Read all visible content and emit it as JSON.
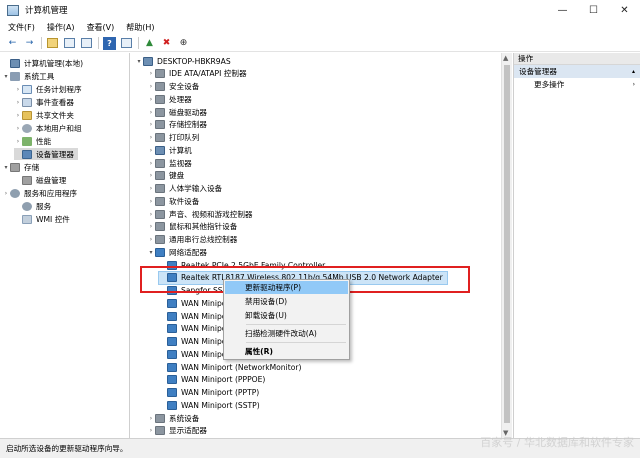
{
  "window": {
    "title": "计算机管理"
  },
  "window_controls": {
    "minimize": "—",
    "maximize": "☐",
    "close": "✕"
  },
  "menu": [
    "文件(F)",
    "操作(A)",
    "查看(V)",
    "帮助(H)"
  ],
  "toolbar_glyphs": {
    "back": "←",
    "forward": "→",
    "help": "?",
    "update": "▲",
    "delete": "✖",
    "scan": "⊕"
  },
  "left_tree": [
    {
      "label": "计算机管理(本地)",
      "icon": "computer-icon",
      "exp": ""
    },
    {
      "label": "系统工具",
      "icon": "tools-icon",
      "exp": "▾"
    },
    {
      "label": "任务计划程序",
      "icon": "task-scheduler-icon",
      "exp": "›"
    },
    {
      "label": "事件查看器",
      "icon": "event-viewer-icon",
      "exp": "›"
    },
    {
      "label": "共享文件夹",
      "icon": "shared-folder-icon",
      "exp": "›"
    },
    {
      "label": "本地用户和组",
      "icon": "users-icon",
      "exp": "›"
    },
    {
      "label": "性能",
      "icon": "performance-icon",
      "exp": "›"
    },
    {
      "label": "设备管理器",
      "icon": "device-manager-icon",
      "exp": ""
    },
    {
      "label": "存储",
      "icon": "storage-icon",
      "exp": "▾"
    },
    {
      "label": "磁盘管理",
      "icon": "disk-icon",
      "exp": ""
    },
    {
      "label": "服务和应用程序",
      "icon": "services-apps-icon",
      "exp": "›"
    },
    {
      "label": "服务",
      "icon": "services-icon",
      "exp": ""
    },
    {
      "label": "WMI 控件",
      "icon": "wmi-icon",
      "exp": ""
    }
  ],
  "device_tree": [
    {
      "label": "DESKTOP-HBKR9AS",
      "icon": "computer-icon",
      "exp": "▾"
    },
    {
      "label": "IDE ATA/ATAPI 控制器",
      "icon": "ide-controller-icon",
      "exp": "›"
    },
    {
      "label": "安全设备",
      "icon": "security-device-icon",
      "exp": "›"
    },
    {
      "label": "处理器",
      "icon": "processor-icon",
      "exp": "›"
    },
    {
      "label": "磁盘驱动器",
      "icon": "disk-drive-icon",
      "exp": "›"
    },
    {
      "label": "存储控制器",
      "icon": "storage-controller-icon",
      "exp": "›"
    },
    {
      "label": "打印队列",
      "icon": "printer-icon",
      "exp": "›"
    },
    {
      "label": "计算机",
      "icon": "computer-icon",
      "exp": "›"
    },
    {
      "label": "监视器",
      "icon": "monitor-icon",
      "exp": "›"
    },
    {
      "label": "键盘",
      "icon": "keyboard-icon",
      "exp": "›"
    },
    {
      "label": "人体学输入设备",
      "icon": "hid-icon",
      "exp": "›"
    },
    {
      "label": "软件设备",
      "icon": "software-device-icon",
      "exp": "›"
    },
    {
      "label": "声音、视频和游戏控制器",
      "icon": "sound-icon",
      "exp": "›"
    },
    {
      "label": "鼠标和其他指针设备",
      "icon": "mouse-icon",
      "exp": "›"
    },
    {
      "label": "通用串行总线控制器",
      "icon": "usb-icon",
      "exp": "›"
    },
    {
      "label": "网络适配器",
      "icon": "network-adapter-icon",
      "exp": "▾"
    },
    {
      "label": "Realtek PCIe 2.5GbE Family Controller",
      "icon": "network-adapter-icon",
      "exp": ""
    },
    {
      "label": "Realtek RTL8187 Wireless 802.11b/g 54Mb USB 2.0 Network Adapter",
      "icon": "network-adapter-icon",
      "exp": ""
    },
    {
      "label": "Sangfor SSL VPN CS Support System VNIC",
      "icon": "network-adapter-icon",
      "exp": ""
    },
    {
      "label": "WAN Miniport (IKEv2)",
      "icon": "network-adapter-icon",
      "exp": ""
    },
    {
      "label": "WAN Miniport (IP)",
      "icon": "network-adapter-icon",
      "exp": ""
    },
    {
      "label": "WAN Miniport (IPv6)",
      "icon": "network-adapter-icon",
      "exp": ""
    },
    {
      "label": "WAN Miniport (L2TP)",
      "icon": "network-adapter-icon",
      "exp": ""
    },
    {
      "label": "WAN Miniport (Network Monitor)",
      "icon": "network-adapter-icon",
      "exp": ""
    },
    {
      "label": "WAN Miniport (NetworkMonitor)",
      "icon": "network-adapter-icon",
      "exp": ""
    },
    {
      "label": "WAN Miniport (PPPOE)",
      "icon": "network-adapter-icon",
      "exp": ""
    },
    {
      "label": "WAN Miniport (PPTP)",
      "icon": "network-adapter-icon",
      "exp": ""
    },
    {
      "label": "WAN Miniport (SSTP)",
      "icon": "network-adapter-icon",
      "exp": ""
    },
    {
      "label": "系统设备",
      "icon": "system-device-icon",
      "exp": "›"
    },
    {
      "label": "显示适配器",
      "icon": "display-adapter-icon",
      "exp": "›"
    },
    {
      "label": "音频输入和输出",
      "icon": "audio-icon",
      "exp": "›"
    }
  ],
  "context_menu": [
    {
      "label": "更新驱动程序(P)"
    },
    {
      "label": "禁用设备(D)"
    },
    {
      "label": "卸载设备(U)"
    },
    {
      "label": "扫描检测硬件改动(A)"
    },
    {
      "label": "属性(R)"
    }
  ],
  "actions_pane": {
    "header": "操作",
    "section": "设备管理器",
    "more": "更多操作",
    "caret_section": "▴",
    "caret_more": "›"
  },
  "status_text": "启动所选设备的更新驱动程序向导。",
  "watermark": "百家号 / 华北数据库和软件专家",
  "colors": {
    "selection": "#cce4f7",
    "highlight_border": "#e02020",
    "menu_hover": "#91c9f7"
  }
}
